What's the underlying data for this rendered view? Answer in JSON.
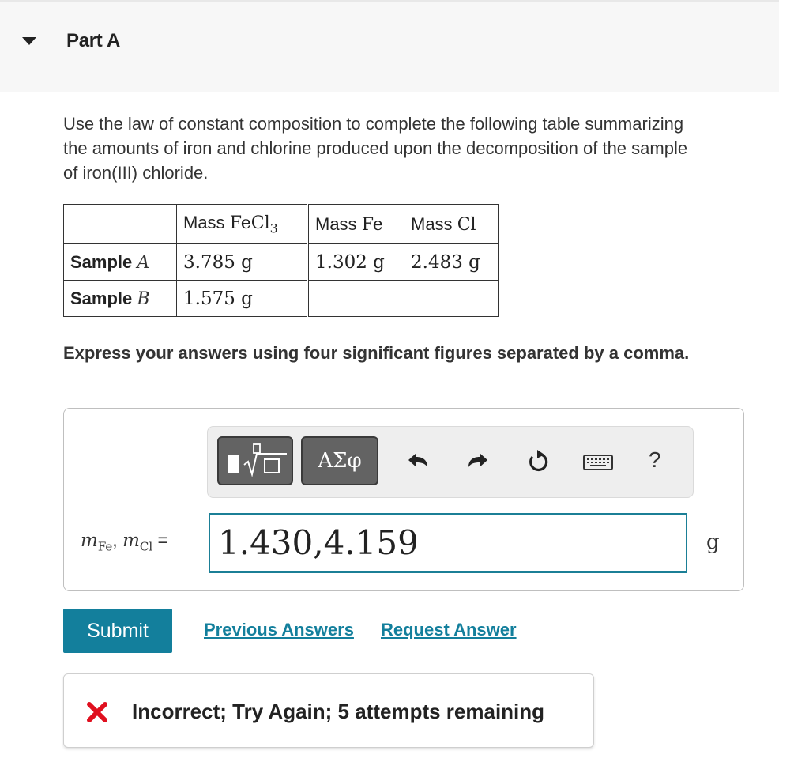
{
  "part": {
    "title": "Part A",
    "collapse_icon": "caret-down-icon"
  },
  "question": {
    "text": "Use the law of constant composition to complete the following table summarizing the amounts of iron and chlorine produced upon the decomposition of the sample of iron(III) chloride."
  },
  "table": {
    "headers": [
      {
        "prefix": "Mass ",
        "formula": "FeCl",
        "sub": "3"
      },
      {
        "prefix": "Mass ",
        "formula": "Fe",
        "sub": ""
      },
      {
        "prefix": "Mass ",
        "formula": "Cl",
        "sub": ""
      }
    ],
    "rows": [
      {
        "label": "Sample ",
        "var": "A",
        "cells": [
          "3.785 g",
          "1.302 g",
          "2.483 g"
        ]
      },
      {
        "label": "Sample ",
        "var": "B",
        "cells": [
          "1.575 g",
          "",
          ""
        ]
      }
    ]
  },
  "instruction": "Express your answers using four significant figures separated by a comma.",
  "toolbar": {
    "templates_icon": "templates-icon",
    "greek_label": "ΑΣφ",
    "undo_icon": "undo-icon",
    "redo_icon": "redo-icon",
    "reset_icon": "reset-icon",
    "keyboard_icon": "keyboard-icon",
    "help_label": "?"
  },
  "answer": {
    "var1": "m",
    "var1_sub": "Fe",
    "var2": "m",
    "var2_sub": "Cl",
    "equals": " =",
    "value": "1.430,4.159",
    "unit": "g"
  },
  "actions": {
    "submit": "Submit",
    "previous_answers": "Previous Answers",
    "request_answer": "Request Answer"
  },
  "feedback": {
    "icon": "error-x-icon",
    "text": "Incorrect; Try Again; 5 attempts remaining",
    "color": "#e0101f"
  }
}
